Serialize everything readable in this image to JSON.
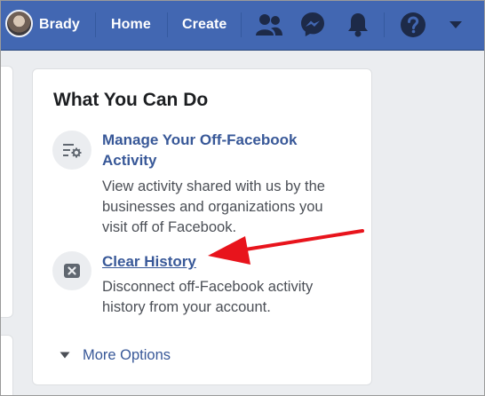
{
  "topbar": {
    "user_name": "Brady",
    "home_label": "Home",
    "create_label": "Create",
    "icons": [
      "friends-icon",
      "messenger-icon",
      "notifications-bell-icon",
      "help-icon",
      "account-dropdown-icon"
    ]
  },
  "card": {
    "title": "What You Can Do",
    "items": [
      {
        "icon": "settings-list-icon",
        "title_line1": "Manage Your Off-Facebook",
        "title_line2": "Activity",
        "desc_line1": "View activity shared with us by the",
        "desc_line2": "businesses and organizations you",
        "desc_line3": "visit off of Facebook."
      },
      {
        "icon": "clear-x-icon",
        "title": "Clear History",
        "desc_line1": "Disconnect off-Facebook activity",
        "desc_line2": "history from your account."
      }
    ],
    "more_options_label": "More Options"
  },
  "colors": {
    "topbar": "#4267b2",
    "link": "#385898",
    "annotation_arrow": "#e8141c"
  }
}
